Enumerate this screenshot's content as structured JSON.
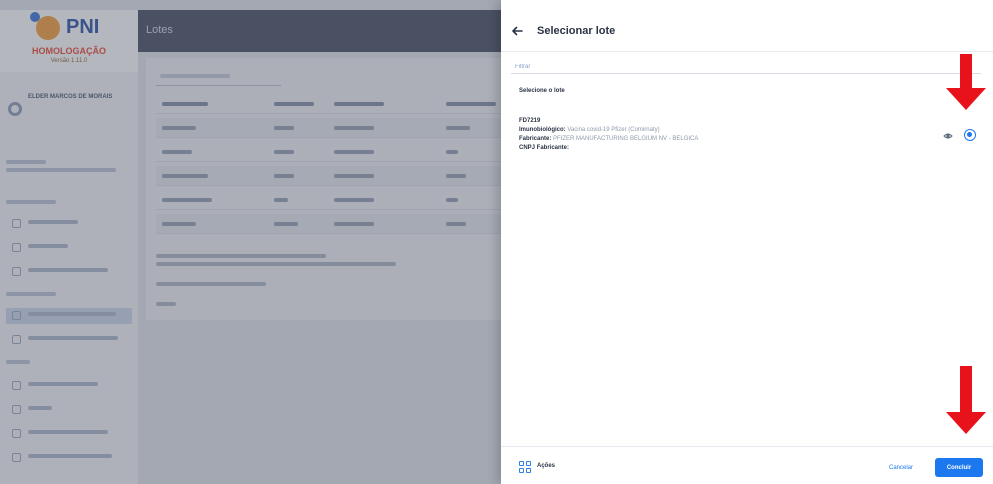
{
  "background_app": {
    "brand": {
      "logo_text": "PNI",
      "environment": "HOMOLOGAÇÃO",
      "version": "Versão 1.11.0"
    },
    "user": {
      "name": "ELDER MARCOS DE MORAIS"
    },
    "page_title": "Lotes"
  },
  "drawer": {
    "title": "Selecionar lote",
    "search_placeholder": "Filtrar",
    "section_label": "Selecione o lote",
    "lot": {
      "code": "FD7219",
      "immunobiological_label": "Imunobiológico:",
      "immunobiological_value": "Vacina covid-19 Pfizer (Comirnaty)",
      "manufacturer_label": "Fabricante:",
      "manufacturer_value": "PFIZER MANUFACTURING BELGIUM NV - BELGICA",
      "cnpj_label": "CNPJ Fabricante:",
      "cnpj_value": "",
      "selected": true
    },
    "footer": {
      "actions_label": "Ações",
      "cancel_label": "Cancelar",
      "confirm_label": "Concluir"
    }
  },
  "colors": {
    "accent": "#1c78ef",
    "annotation_arrow": "#e8131a",
    "brand_orange": "#f29a2e",
    "brand_blue": "#1f4aa0"
  },
  "icons": {
    "back": "arrow-left-icon",
    "view": "eye-icon",
    "actions": "grid-icon"
  }
}
